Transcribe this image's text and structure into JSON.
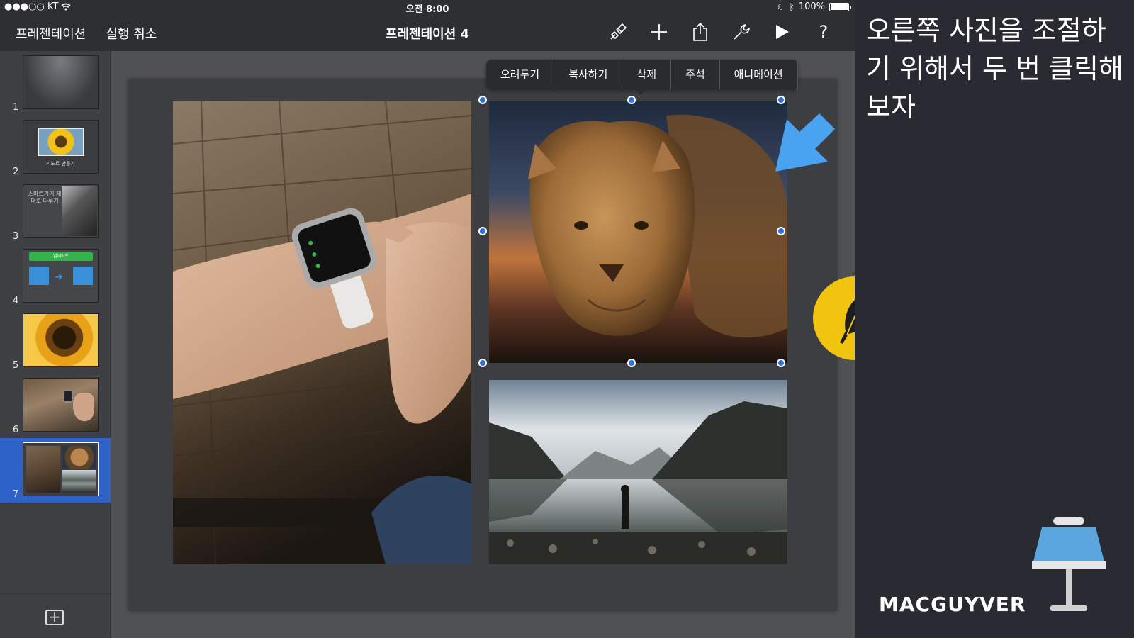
{
  "statusbar": {
    "carrier": "●●●○○ KT",
    "time": "오전 8:00",
    "battery": "100%",
    "battery_level": 1.0
  },
  "navbar": {
    "presentations_label": "프레젠테이션",
    "undo_label": "실행 취소",
    "title": "프레젠테이션 4",
    "icons": [
      "format-brush-icon",
      "add-icon",
      "share-icon",
      "tools-wrench-icon",
      "play-icon",
      "help-icon"
    ],
    "help_glyph": "?"
  },
  "sidebar": {
    "slides": [
      {
        "number": "1"
      },
      {
        "number": "2",
        "caption": "키노트 만들기"
      },
      {
        "number": "3",
        "caption": "스마트기기 제대로 다루기"
      },
      {
        "number": "4",
        "caption": "업데이트"
      },
      {
        "number": "5"
      },
      {
        "number": "6"
      },
      {
        "number": "7",
        "selected": true
      }
    ],
    "add_slide_glyph": "+"
  },
  "context_menu": {
    "items": [
      "오려두기",
      "복사하기",
      "삭제",
      "주석",
      "애니메이션"
    ]
  },
  "panel": {
    "caption": "오른쪽 사진을 조절하기 위해서 두 번 클릭해보자",
    "brand": "MACGUYVER"
  },
  "colors": {
    "selection": "#2f62c8",
    "handle": "#2f6fe0",
    "arrow": "#4aa3f0",
    "badge": "#f1c40f"
  }
}
